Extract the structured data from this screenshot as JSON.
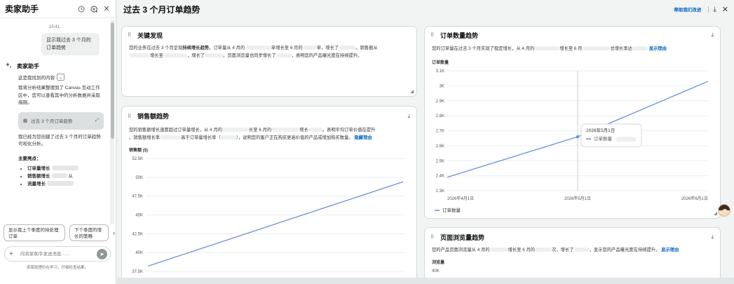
{
  "assistant": {
    "title": "卖家助手",
    "time": "15:41",
    "user_message": "显示我过去 3 个月的订单趋势",
    "bot_name": "卖家助手",
    "found_label": "这是我找到的内容",
    "para1": "我将分析结果整理到了 Canvas 互动工作区中，您可以查看其中的分析数据并采取措施。",
    "canvas_card_label": "过去 3 个月订单趋势",
    "para2": "我已经为您创建了过去 3 个月的订单趋势可视化分析。",
    "main_points_title": "主要亮点：",
    "points": [
      "订单量增长",
      "销售额增长",
      "流量增长"
    ],
    "points_tail": [
      "",
      "从",
      ""
    ],
    "suggestions": [
      "显示我上个季度的待处理订单",
      "下个季度的增长的策略"
    ],
    "input_placeholder": "向卖家助手发送消息......",
    "disclaimer": "卖家助理仍在学习，仔细检查结果。"
  },
  "main": {
    "title": "过去 3 个月订单趋势",
    "help_link": "帮助我们改进"
  },
  "key_findings": {
    "title": "关键发现",
    "text_a": "您的业务在过去 3 个月呈现",
    "text_b": "持续增长趋势",
    "text_c": "。订单量从 4 月的",
    "text_d": "单增长至 6 月的",
    "text_e": "单，增长了",
    "text_f": "。销售额从",
    "text_g": "增长至",
    "text_h": "，增长了",
    "text_i": "。页面浏览量也同步增长了",
    "text_j": "，表明您的产品曝光度在持续提升。"
  },
  "sales": {
    "title": "销售额趋势",
    "text_a": "您的销售额增长速度超过订单量增长，从 4 月的",
    "text_b": "长至 6 月的",
    "text_c": "增长",
    "text_d": "。表明平均订单价值在提升",
    "text_e": "。销售额增长率",
    "text_f": "高于订单量增长率（",
    "text_g": "），说明您的客户正在购买更高价值的产品或增加购买数量。",
    "hide_link": "隐藏理由",
    "ylabel": "销售额 ($)"
  },
  "orders": {
    "title": "订单数量趋势",
    "text_a": "您的订单量在过去 3 个月实现了稳定增长，从 4 月的",
    "text_b": "增长至 6 月",
    "text_c": "总增长率达",
    "show_link": "显示理由",
    "ylabel": "订单数量",
    "tooltip_date": "2026年5月1日",
    "tooltip_series": "订单数量",
    "legend": "订单数量"
  },
  "pageviews": {
    "title": "页面浏览量趋势",
    "text_a": "您的产品页面浏览量从 4 月的",
    "text_b": "增长至 6 月的",
    "text_c": "次，增长了",
    "text_d": "，显示您的产品曝光度在持续提升。",
    "show_link": "显示理由",
    "ylabel": "浏览量",
    "first_tick": "40K"
  },
  "chart_data": [
    {
      "type": "line",
      "title": "",
      "ylabel": "销售额 ($)",
      "yticks": [
        "52.5K",
        "50K",
        "47.5K",
        "45K",
        "42.5K",
        "40K",
        "37.5K"
      ],
      "ylim": [
        37500,
        52500
      ],
      "series": [
        {
          "values": [
            38200,
            49400
          ]
        }
      ],
      "line_color": "#6b8fd6"
    },
    {
      "type": "line",
      "title": "",
      "ylabel": "订单数量",
      "x": [
        "2026年4月1日",
        "2026年5月1日",
        "2026年6月1日"
      ],
      "yticks": [
        "3.1K",
        "3K",
        "2.9K",
        "2.8K",
        "2.7K",
        "2.6K",
        "2.5K",
        "2.4K",
        "2.3K"
      ],
      "ylim": [
        2300,
        3100
      ],
      "series": [
        {
          "name": "订单数量",
          "values": [
            2390,
            2660,
            3030
          ]
        }
      ],
      "line_color": "#6b8fd6"
    }
  ]
}
